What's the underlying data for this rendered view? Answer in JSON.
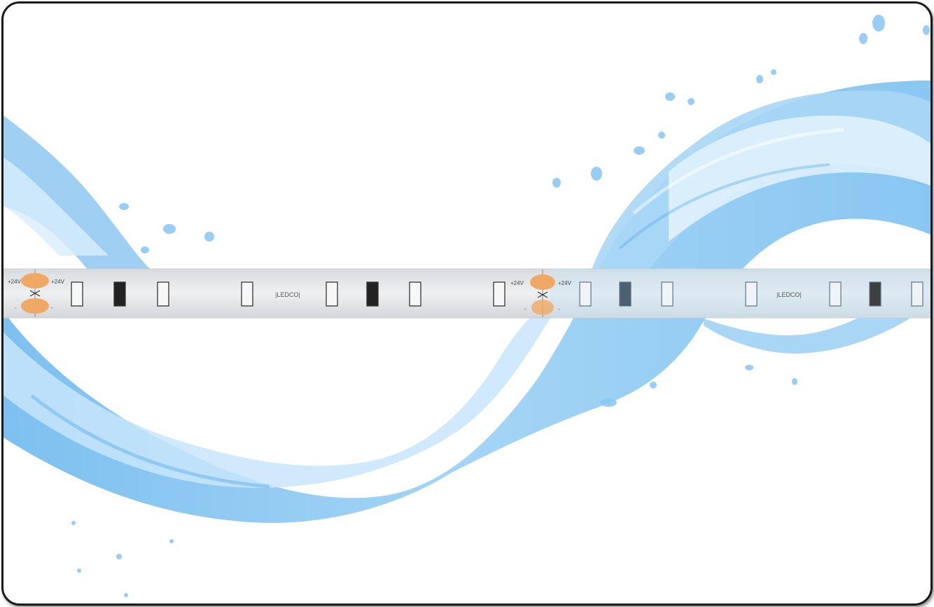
{
  "scene": {
    "subject": "LED strip light over water splash",
    "colors": {
      "water_light": "#cfe8fb",
      "water_mid": "#8ec8f2",
      "water_dark": "#5aaee8",
      "strip": "#e6e8ea",
      "strip_edge": "#c9ccd0",
      "solder_pad": "#f0a866",
      "frame_border": "#1a1a1a"
    }
  },
  "strip": {
    "segments": [
      {
        "voltage_left": "+24V",
        "voltage_right": "+24V",
        "minus_left": "-",
        "minus_right": "-",
        "brand": "|LEDCO|"
      },
      {
        "voltage_left": "+24V",
        "voltage_right": "+24V",
        "minus_left": "-",
        "minus_right": "-",
        "brand": "|LEDCO|"
      }
    ]
  }
}
